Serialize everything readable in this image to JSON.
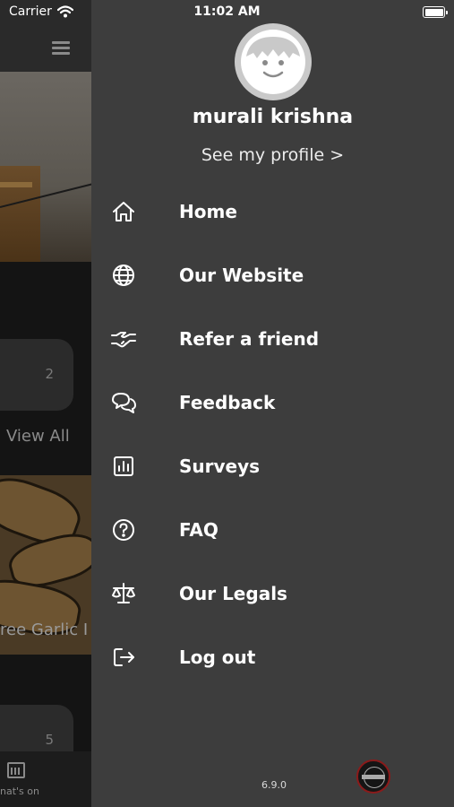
{
  "status_bar": {
    "carrier": "Carrier",
    "time": "11:02 AM"
  },
  "background_app": {
    "card_top_count": "2",
    "view_all": "View All",
    "food_caption": "ree Garlic I",
    "card_bottom_count": "5",
    "tab_label": "nat's on"
  },
  "profile": {
    "name": "murali krishna",
    "see_profile": "See my profile >"
  },
  "menu": [
    {
      "label": "Home",
      "icon": "home-icon"
    },
    {
      "label": "Our Website",
      "icon": "globe-icon"
    },
    {
      "label": "Refer a friend",
      "icon": "handshake-icon"
    },
    {
      "label": "Feedback",
      "icon": "chat-bubbles-icon"
    },
    {
      "label": "Surveys",
      "icon": "bar-chart-icon"
    },
    {
      "label": "FAQ",
      "icon": "question-circle-icon"
    },
    {
      "label": "Our Legals",
      "icon": "scales-icon"
    },
    {
      "label": "Log out",
      "icon": "logout-icon"
    }
  ],
  "version": "6.9.0",
  "colors": {
    "drawer_bg": "#3d3d3d",
    "text": "#ffffff",
    "overlay": "#141414"
  }
}
